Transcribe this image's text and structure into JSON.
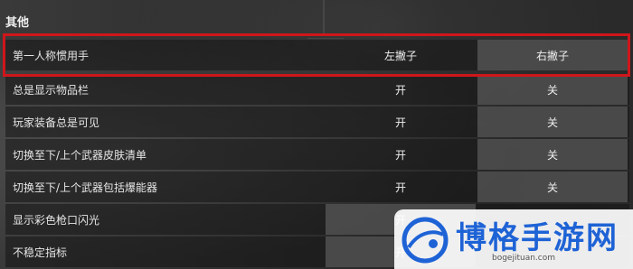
{
  "section": {
    "title": "其他"
  },
  "rows": [
    {
      "label": "第一人称惯用手",
      "left": "左撇子",
      "right": "右撇子",
      "selected": "right"
    },
    {
      "label": "总是显示物品栏",
      "left": "开",
      "right": "关",
      "selected": "right"
    },
    {
      "label": "玩家装备总是可见",
      "left": "开",
      "right": "关",
      "selected": "right"
    },
    {
      "label": "切换至下/上个武器皮肤清单",
      "left": "开",
      "right": "关",
      "selected": "right"
    },
    {
      "label": "切换至下/上个武器包括爆能器",
      "left": "开",
      "right": "关",
      "selected": "right"
    },
    {
      "label": "显示彩色枪口闪光",
      "left": "开",
      "right": "",
      "selected": "left"
    },
    {
      "label": "不稳定指标",
      "left": "开",
      "right": "",
      "selected": "left"
    }
  ],
  "watermark": {
    "name": "博格手游网",
    "url": "bogejituan.com"
  },
  "colors": {
    "highlight": "#d0161b",
    "brand": "#1e63d6"
  }
}
